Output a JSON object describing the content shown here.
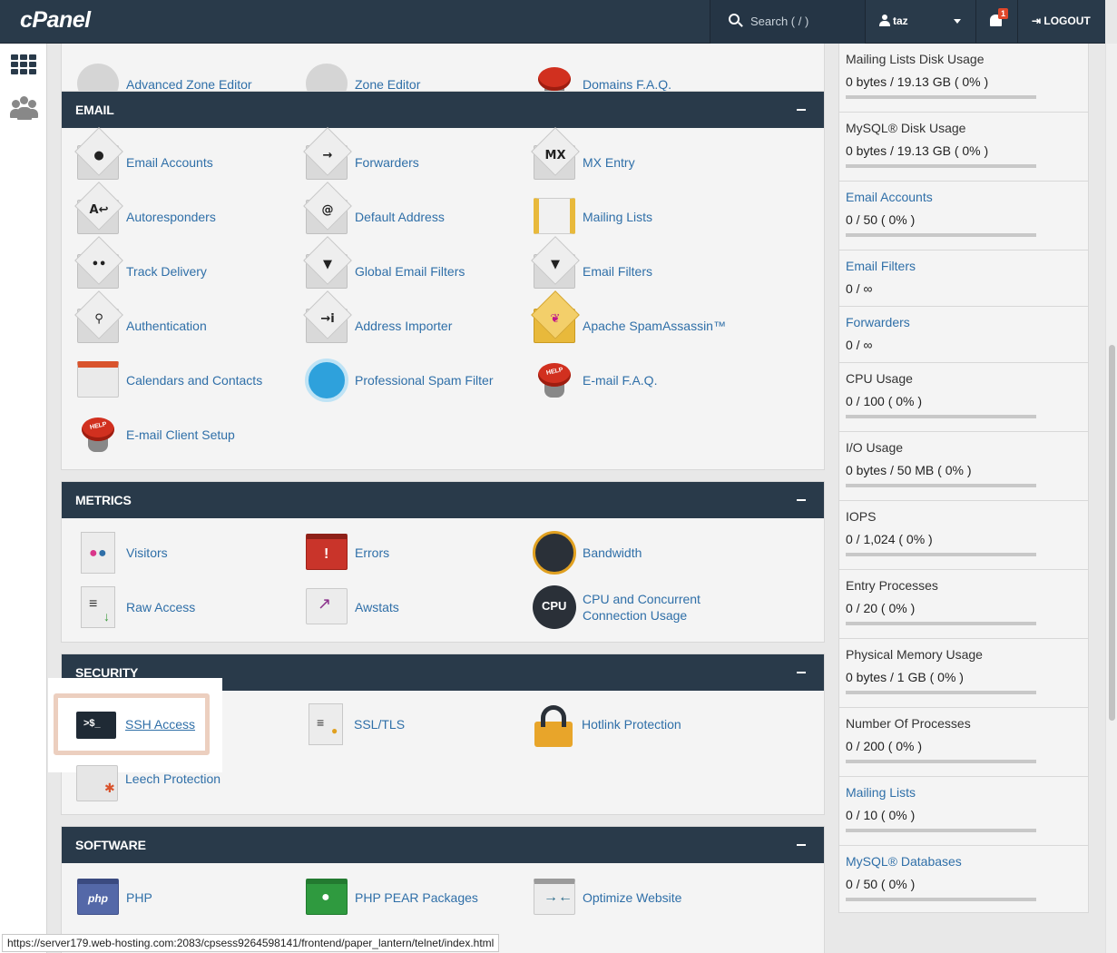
{
  "header": {
    "logo": "cPanel",
    "search_placeholder": "Search ( / )",
    "username": "taz",
    "notification_count": "1",
    "logout_label": "LOGOUT"
  },
  "top_partial": [
    "Advanced Zone Editor",
    "Zone Editor",
    "Domains F.A.Q."
  ],
  "sections": {
    "email": {
      "title": "EMAIL",
      "items": [
        "Email Accounts",
        "Forwarders",
        "MX Entry",
        "Autoresponders",
        "Default Address",
        "Mailing Lists",
        "Track Delivery",
        "Global Email Filters",
        "Email Filters",
        "Authentication",
        "Address Importer",
        "Apache SpamAssassin™",
        "Calendars and Contacts",
        "Professional Spam Filter",
        "E-mail F.A.Q.",
        "E-mail Client Setup"
      ]
    },
    "metrics": {
      "title": "METRICS",
      "items": [
        "Visitors",
        "Errors",
        "Bandwidth",
        "Raw Access",
        "Awstats",
        "CPU and Concurrent Connection Usage"
      ]
    },
    "security": {
      "title": "SECURITY",
      "items": [
        "SSH Access",
        "SSL/TLS",
        "Hotlink Protection",
        "Leech Protection"
      ]
    },
    "software": {
      "title": "SOFTWARE",
      "items": [
        "PHP",
        "PHP PEAR Packages",
        "Optimize Website"
      ]
    }
  },
  "stats": [
    {
      "name": "Mailing Lists Disk Usage",
      "value": "0 bytes / 19.13 GB ( 0% )"
    },
    {
      "name": "MySQL® Disk Usage",
      "value": "0 bytes / 19.13 GB ( 0% )"
    },
    {
      "name": "Email Accounts",
      "value": "0 / 50 ( 0% )"
    },
    {
      "name": "Email Filters",
      "value": "0 / ∞"
    },
    {
      "name": "Forwarders",
      "value": "0 / ∞"
    },
    {
      "name": "CPU Usage",
      "value": "0 / 100 ( 0% )"
    },
    {
      "name": "I/O Usage",
      "value": "0 bytes / 50 MB ( 0% )"
    },
    {
      "name": "IOPS",
      "value": "0 / 1,024 ( 0% )"
    },
    {
      "name": "Entry Processes",
      "value": "0 / 20 ( 0% )"
    },
    {
      "name": "Physical Memory Usage",
      "value": "0 bytes / 1 GB ( 0% )"
    },
    {
      "name": "Number Of Processes",
      "value": "0 / 200 ( 0% )"
    },
    {
      "name": "Mailing Lists",
      "value": "0 / 10 ( 0% )"
    },
    {
      "name": "MySQL® Databases",
      "value": "0 / 50 ( 0% )"
    }
  ],
  "icon_glyphs": {
    "mx": "MX",
    "autoresponders": "A↩",
    "forwarders": "→",
    "default_address": "@",
    "address_importer": "→i",
    "ssh": ">$_",
    "php": "php",
    "cpu": "CPU"
  },
  "colors": {
    "header_bg": "#293a4a",
    "link": "#2f6fa8",
    "panel_bg": "#f4f4f4",
    "highlight": "#eccfbf"
  },
  "status_url": "https://server179.web-hosting.com:2083/cpsess9264598141/frontend/paper_lantern/telnet/index.html"
}
